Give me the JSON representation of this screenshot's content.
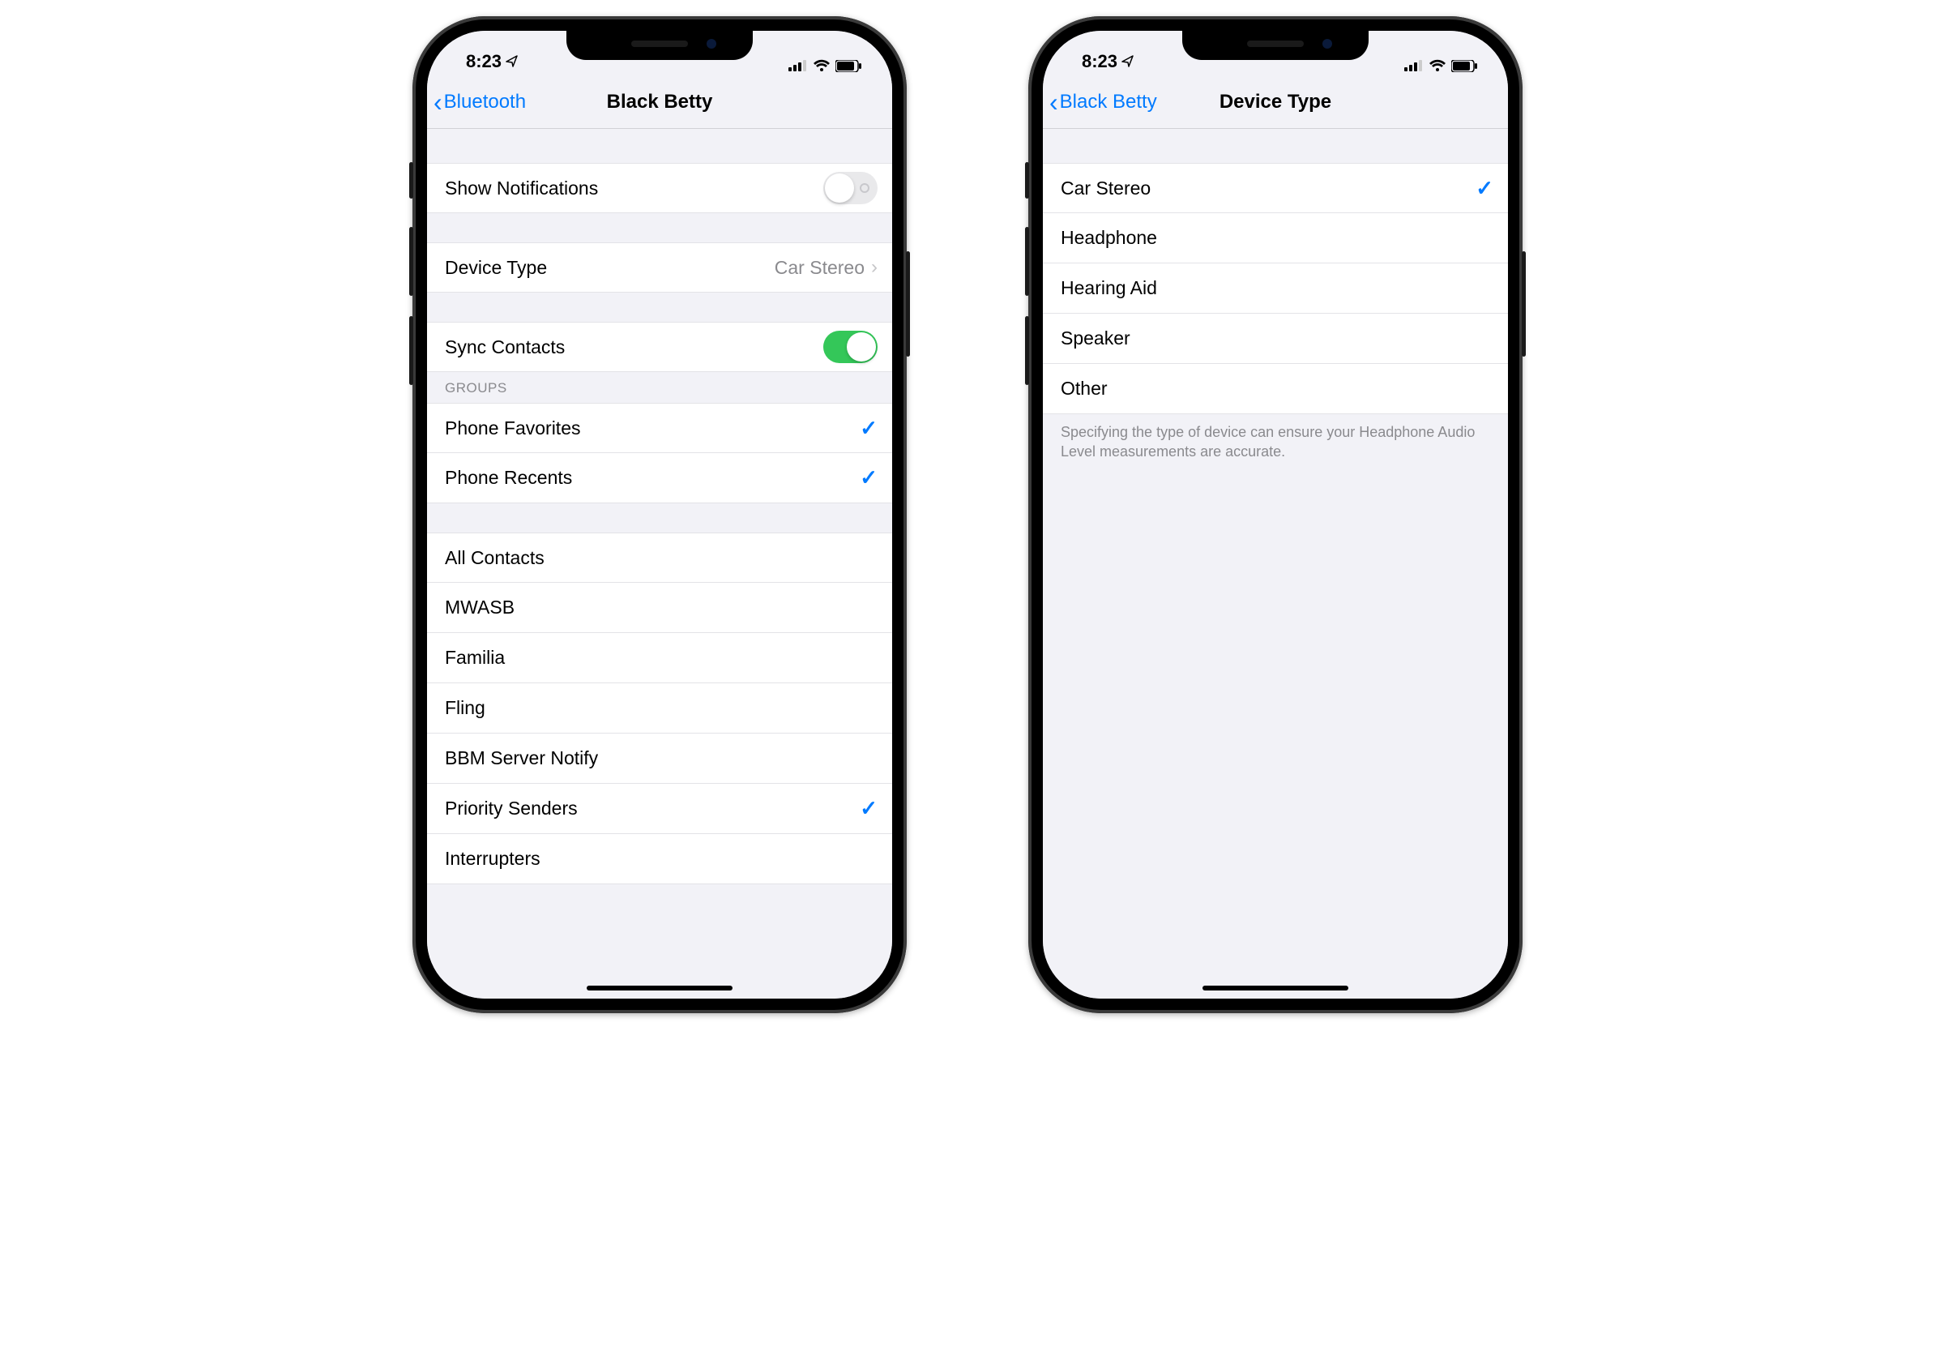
{
  "status": {
    "time": "8:23",
    "location_icon": "location",
    "signal_icon": "signal",
    "wifi_icon": "wifi",
    "battery_icon": "battery"
  },
  "phone1": {
    "nav": {
      "back": "Bluetooth",
      "title": "Black Betty"
    },
    "row_notifications": {
      "label": "Show Notifications",
      "on": false
    },
    "row_device_type": {
      "label": "Device Type",
      "value": "Car Stereo"
    },
    "row_sync_contacts": {
      "label": "Sync Contacts",
      "on": true
    },
    "groups_header": "GROUPS",
    "groups1": [
      {
        "label": "Phone Favorites",
        "checked": true
      },
      {
        "label": "Phone Recents",
        "checked": true
      }
    ],
    "groups2": [
      {
        "label": "All Contacts",
        "checked": false
      },
      {
        "label": "MWASB",
        "checked": false
      },
      {
        "label": "Familia",
        "checked": false
      },
      {
        "label": "Fling",
        "checked": false
      },
      {
        "label": "BBM Server Notify",
        "checked": false
      },
      {
        "label": "Priority Senders",
        "checked": true
      },
      {
        "label": "Interrupters",
        "checked": false
      }
    ]
  },
  "phone2": {
    "nav": {
      "back": "Black Betty",
      "title": "Device Type"
    },
    "options": [
      {
        "label": "Car Stereo",
        "checked": true
      },
      {
        "label": "Headphone",
        "checked": false
      },
      {
        "label": "Hearing Aid",
        "checked": false
      },
      {
        "label": "Speaker",
        "checked": false
      },
      {
        "label": "Other",
        "checked": false
      }
    ],
    "footer": "Specifying the type of device can ensure your Headphone Audio Level measurements are accurate."
  }
}
